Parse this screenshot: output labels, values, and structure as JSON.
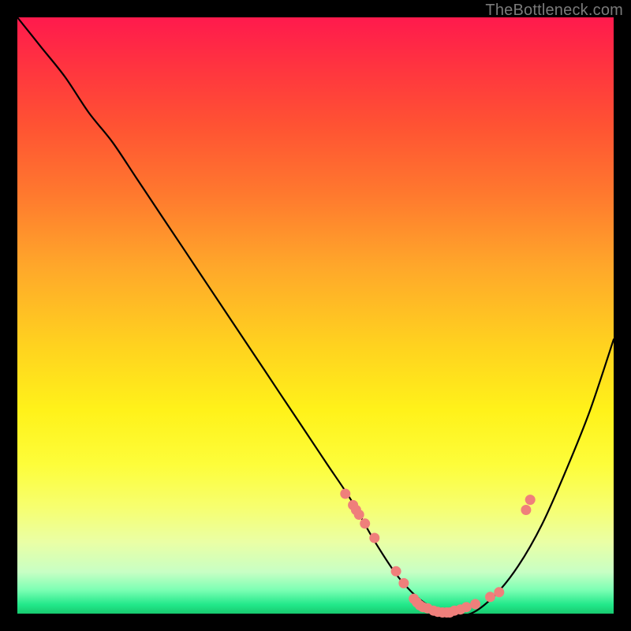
{
  "watermark": "TheBottleneck.com",
  "colors": {
    "curve": "#000000",
    "dot": "#ef7f7b",
    "gradient_top": "#ff1a4d",
    "gradient_bottom": "#18c96f"
  },
  "chart_data": {
    "type": "line",
    "title": "",
    "xlabel": "",
    "ylabel": "",
    "xlim": [
      0,
      100
    ],
    "ylim": [
      0,
      100
    ],
    "x": [
      0,
      4,
      8,
      12,
      16,
      20,
      24,
      28,
      32,
      36,
      40,
      44,
      48,
      52,
      56,
      60,
      64,
      68,
      72,
      76,
      80,
      84,
      88,
      92,
      96,
      100
    ],
    "y": [
      100,
      95,
      90,
      84,
      79,
      73,
      67,
      61,
      55,
      49,
      43,
      37,
      31,
      25,
      19,
      12,
      6,
      2,
      0,
      0,
      3,
      8,
      15,
      24,
      34,
      46
    ],
    "markers": {
      "note": "salmon dots visible on the curve",
      "x": [
        55.0,
        56.3,
        56.8,
        57.3,
        58.3,
        59.9,
        63.5,
        64.8,
        66.5,
        67.0,
        67.5,
        68.0,
        68.8,
        69.8,
        70.5,
        71.3,
        72.0,
        72.5,
        73.3,
        74.3,
        75.3,
        76.8,
        79.3,
        80.8,
        85.3,
        86.0
      ],
      "y": [
        20.1,
        18.2,
        17.4,
        16.6,
        15.1,
        12.7,
        7.1,
        5.1,
        2.5,
        1.9,
        1.4,
        1.1,
        0.9,
        0.5,
        0.3,
        0.2,
        0.2,
        0.2,
        0.5,
        0.7,
        1.1,
        1.6,
        2.8,
        3.6,
        17.4,
        19.1
      ]
    }
  }
}
